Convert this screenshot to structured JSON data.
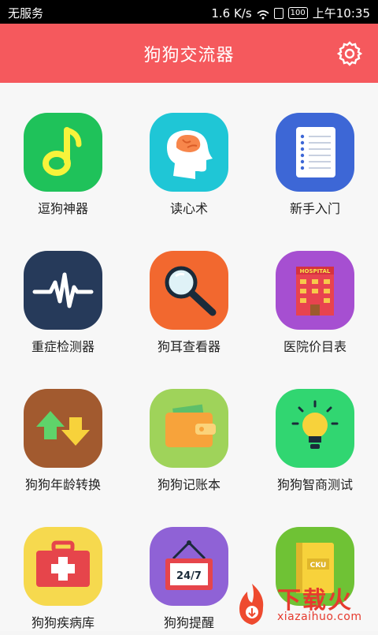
{
  "status_bar": {
    "carrier": "无服务",
    "network_speed": "1.6 K/s",
    "battery": "100",
    "time": "上午10:35"
  },
  "header": {
    "title": "狗狗交流器",
    "settings_icon": "gear-icon"
  },
  "tiles": [
    {
      "label": "逗狗神器",
      "icon": "music-note-icon",
      "color": "#1fc25a"
    },
    {
      "label": "读心术",
      "icon": "brain-head-icon",
      "color": "#1fc6d6"
    },
    {
      "label": "新手入门",
      "icon": "notebook-icon",
      "color": "#3d67d6"
    },
    {
      "label": "重症检测器",
      "icon": "heartbeat-icon",
      "color": "#263a5a"
    },
    {
      "label": "狗耳查看器",
      "icon": "magnifier-icon",
      "color": "#f2682f"
    },
    {
      "label": "医院价目表",
      "icon": "hospital-icon",
      "color": "#a64fd1"
    },
    {
      "label": "狗狗年龄转换",
      "icon": "swap-arrows-icon",
      "color": "#a25a2f"
    },
    {
      "label": "狗狗记账本",
      "icon": "wallet-icon",
      "color": "#9fd35a"
    },
    {
      "label": "狗狗智商测试",
      "icon": "lightbulb-icon",
      "color": "#31d671"
    },
    {
      "label": "狗狗疾病库",
      "icon": "first-aid-kit-icon",
      "color": "#f6d94e"
    },
    {
      "label": "狗狗提醒",
      "icon": "24-7-sign-icon",
      "color": "#8f62d6"
    },
    {
      "label": "",
      "icon": "book-icon",
      "color": "#6fc235"
    }
  ],
  "icon_text": {
    "hospital": "HOSPITAL",
    "sign": "24/7",
    "book": "CKU"
  },
  "watermark": {
    "title": "下载火",
    "url": "xiazaihuo.com"
  }
}
